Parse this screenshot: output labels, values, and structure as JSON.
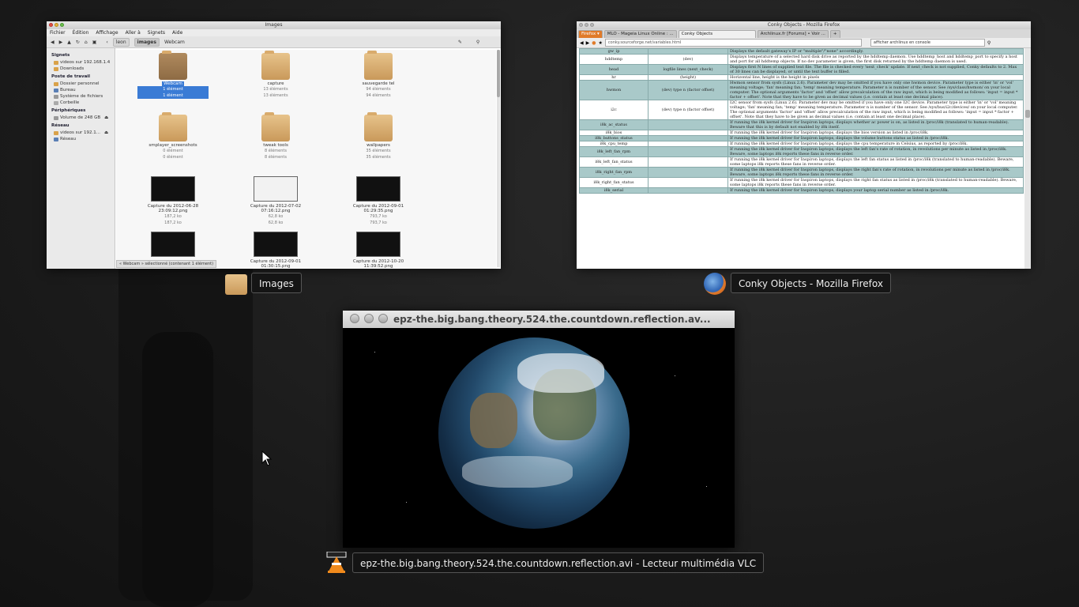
{
  "images_window": {
    "title": "Images",
    "menu": [
      "Fichier",
      "Édition",
      "Affichage",
      "Aller à",
      "Signets",
      "Aide"
    ],
    "breadcrumb": [
      "leon",
      "images",
      "Webcam"
    ],
    "sidebar": {
      "sections": [
        {
          "heading": "Signets",
          "items": [
            "videos sur 192.168.1.4",
            "Downloads"
          ]
        },
        {
          "heading": "Poste de travail",
          "items": [
            "Dossier personnel",
            "Bureau",
            "Système de fichiers",
            "Corbeille"
          ]
        },
        {
          "heading": "Périphériques",
          "items": [
            "Volume de 248 GB"
          ]
        },
        {
          "heading": "Réseau",
          "items": [
            "videos sur 192.1...",
            "Réseau"
          ]
        }
      ]
    },
    "files": [
      {
        "name": "Webcam",
        "line1": "1 élément",
        "line2": "1 élément",
        "kind": "folder-dark",
        "selected": true
      },
      {
        "name": "capture",
        "line1": "13 éléments",
        "line2": "13 éléments",
        "kind": "folder"
      },
      {
        "name": "sauvegarde tel",
        "line1": "94 éléments",
        "line2": "94 éléments",
        "kind": "folder"
      },
      {
        "name": "smplayer_screenshots",
        "line1": "0 élément",
        "line2": "0 élément",
        "kind": "folder"
      },
      {
        "name": "tweak tools",
        "line1": "8 éléments",
        "line2": "8 éléments",
        "kind": "folder"
      },
      {
        "name": "wallpapers",
        "line1": "35 éléments",
        "line2": "35 éléments",
        "kind": "folder"
      },
      {
        "name": "Capture du 2012-06-28 23:09:12.png",
        "line1": "187,2 ko",
        "line2": "187,2 ko",
        "kind": "thumb"
      },
      {
        "name": "Capture du 2012-07-02 07:16:12.png",
        "line1": "62,8 ko",
        "line2": "62,8 ko",
        "kind": "thumb-white"
      },
      {
        "name": "Capture du 2012-09-01 01:29:35.png",
        "line1": "793,7 ko",
        "line2": "793,7 ko",
        "kind": "thumb"
      },
      {
        "name": "",
        "line1": "",
        "line2": "",
        "kind": "thumb"
      },
      {
        "name": "Capture du 2012-09-01 01:30:15.png",
        "line1": "",
        "line2": "",
        "kind": "thumb"
      },
      {
        "name": "Capture du 2012-10-20 11:39:52.png",
        "line1": "",
        "line2": "",
        "kind": "thumb"
      }
    ],
    "status": "« Webcam » sélectionné (contenant 1 élément)",
    "label": "Images"
  },
  "firefox_window": {
    "title": "Conky Objects - Mozilla Firefox",
    "menu_button": "Firefox ▾",
    "tabs": [
      "MLO - Mageia Linux Online : ...",
      "Conky Objects",
      "Archlinux.fr [Forums] • Voir ..."
    ],
    "url": "conky.sourceforge.net/variables.html",
    "search": "afficher archlinux en console",
    "rows": [
      {
        "name": "gw_ip",
        "args": "",
        "desc": "Displays the default gateway's IP or \"multiple\"/\"none\" accordingly.",
        "alt": true
      },
      {
        "name": "hddtemp",
        "args": "(dev)",
        "desc": "Displays temperature of a selected hard disk drive as reported by the hddtemp daemon. Use hddtemp_host and hddtemp_port to specify a host and port for all hddtemp objects. If no dev parameter is given, the first disk returned by the hddtemp daemon is used.",
        "alt": false
      },
      {
        "name": "head",
        "args": "logfile lines (next_check)",
        "desc": "Displays first N lines of supplied text file. The file is checked every 'next_check' update. If next_check is not supplied, Conky defaults to 2. Max of 30 lines can be displayed, or until the text buffer is filled.",
        "alt": true
      },
      {
        "name": "hr",
        "args": "(height)",
        "desc": "Horizontal line, height is the height in pixels",
        "alt": false
      },
      {
        "name": "hwmon",
        "args": "(dev) type n (factor offset)",
        "desc": "Hwmon sensor from sysfs (Linux 2.6). Parameter dev may be omitted if you have only one hwmon device. Parameter type is either 'in' or 'vol' meaning voltage; 'fan' meaning fan; 'temp' meaning temperature. Parameter n is number of the sensor. See /sys/class/hwmon/ on your local computer. The optional arguments 'factor' and 'offset' allow precalculation of the raw input, which is being modified as follows: 'input = input * factor + offset'. Note that they have to be given as decimal values (i.e. contain at least one decimal place).",
        "alt": true
      },
      {
        "name": "i2c",
        "args": "(dev) type n (factor offset)",
        "desc": "I2C sensor from sysfs (Linux 2.6). Parameter dev may be omitted if you have only one I2C device. Parameter type is either 'in' or 'vol' meaning voltage; 'fan' meaning fan; 'temp' meaning temperature. Parameter n is number of the sensor. See /sys/bus/i2c/devices/ on your local computer. The optional arguments 'factor' and 'offset' allow precalculation of the raw input, which is being modified as follows: 'input = input * factor + offset'. Note that they have to be given as decimal values (i.e. contain at least one decimal place).",
        "alt": false
      },
      {
        "name": "i8k_ac_status",
        "args": "",
        "desc": "If running the i8k kernel driver for Inspiron laptops, displays whether ac power is on, as listed in /proc/i8k (translated to human-readable). Beware that this is by default not enabled by i8k itself.",
        "alt": true
      },
      {
        "name": "i8k_bios",
        "args": "",
        "desc": "If running the i8k kernel driver for Inspiron laptops, displays the bios version as listed in /proc/i8k.",
        "alt": false
      },
      {
        "name": "i8k_buttons_status",
        "args": "",
        "desc": "If running the i8k kernel driver for Inspiron laptops, displays the volume buttons status as listed in /proc/i8k.",
        "alt": true
      },
      {
        "name": "i8k_cpu_temp",
        "args": "",
        "desc": "If running the i8k kernel driver for Inspiron laptops, displays the cpu temperature in Celsius, as reported by /proc/i8k.",
        "alt": false
      },
      {
        "name": "i8k_left_fan_rpm",
        "args": "",
        "desc": "If running the i8k kernel driver for Inspiron laptops, displays the left fan's rate of rotation, in revolutions per minute as listed in /proc/i8k. Beware, some laptops i8k reports these fans in reverse order.",
        "alt": true
      },
      {
        "name": "i8k_left_fan_status",
        "args": "",
        "desc": "If running the i8k kernel driver for Inspiron laptops, displays the left fan status as listed in /proc/i8k (translated to human-readable). Beware, some laptops i8k reports these fans in reverse order.",
        "alt": false
      },
      {
        "name": "i8k_right_fan_rpm",
        "args": "",
        "desc": "If running the i8k kernel driver for Inspiron laptops, displays the right fan's rate of rotation, in revolutions per minute as listed in /proc/i8k. Beware, some laptops i8k reports these fans in reverse order.",
        "alt": true
      },
      {
        "name": "i8k_right_fan_status",
        "args": "",
        "desc": "If running the i8k kernel driver for Inspiron laptops, displays the right fan status as listed in /proc/i8k (translated to human-readable). Beware, some laptops i8k reports these fans in reverse order.",
        "alt": false
      },
      {
        "name": "i8k_serial",
        "args": "",
        "desc": "If running the i8k kernel driver for Inspiron laptops, displays your laptop serial number as listed in /proc/i8k.",
        "alt": true
      }
    ],
    "label": "Conky Objects - Mozilla Firefox"
  },
  "vlc_window": {
    "title": "epz-the.big.bang.theory.524.the.countdown.reflection.av...",
    "label": "epz-the.big.bang.theory.524.the.countdown.reflection.avi - Lecteur multimédia VLC"
  },
  "colors": {
    "table_alt": "#a9c9c9",
    "selection": "#3a7bd5",
    "label_bg": "#141414"
  }
}
